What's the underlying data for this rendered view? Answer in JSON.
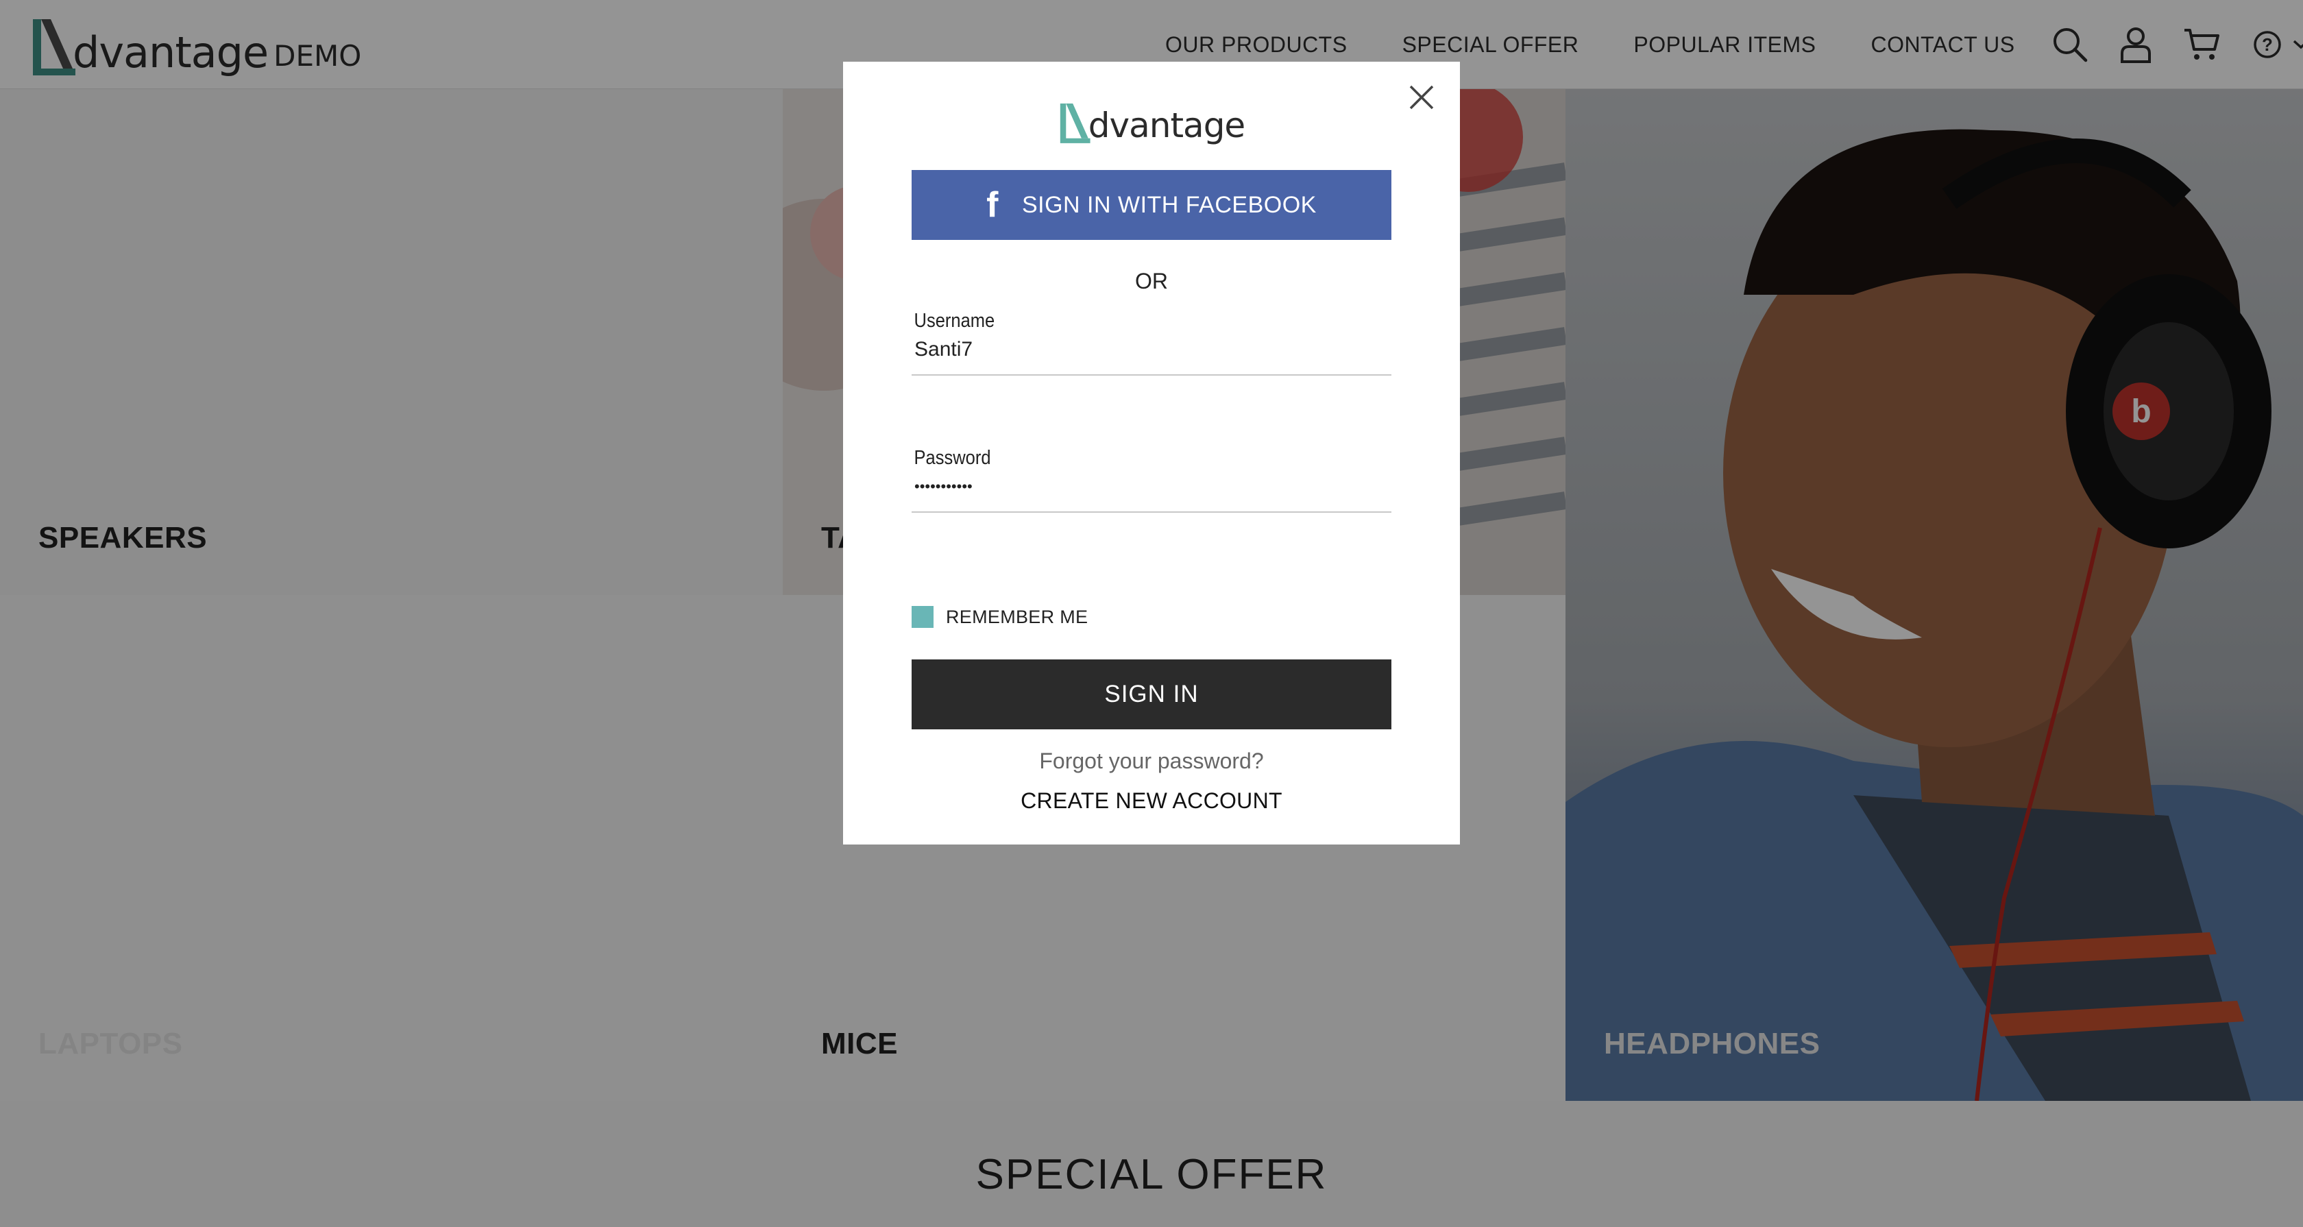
{
  "header": {
    "brand": {
      "word": "dvantage",
      "suffix": "DEMO"
    },
    "nav": [
      "OUR PRODUCTS",
      "SPECIAL OFFER",
      "POPULAR ITEMS",
      "CONTACT US"
    ],
    "icons": [
      "search-icon",
      "user-icon",
      "cart-icon",
      "help-icon",
      "chevron-down-icon"
    ]
  },
  "categories": {
    "speakers": "SPEAKERS",
    "tablets": "TA",
    "laptops": "LAPTOPS",
    "mice": "MICE",
    "headphones": "HEADPHONES"
  },
  "special_offer": {
    "title": "SPECIAL OFFER"
  },
  "modal": {
    "logo_word": "dvantage",
    "facebook_label": "SIGN IN WITH FACEBOOK",
    "facebook_icon": "f",
    "or_text": "OR",
    "username": {
      "label": "Username",
      "value": "Santi7"
    },
    "password": {
      "label": "Password",
      "value": "•••••••••••"
    },
    "remember_label": "REMEMBER ME",
    "remember_checked": true,
    "signin_label": "SIGN IN",
    "forgot_label": "Forgot your password?",
    "create_label": "CREATE NEW ACCOUNT"
  },
  "colors": {
    "brand_teal": "#3f8f86",
    "facebook_blue": "#4a64a8",
    "checkbox_teal": "#69b6b6",
    "dark_button": "#2b2b2b"
  }
}
